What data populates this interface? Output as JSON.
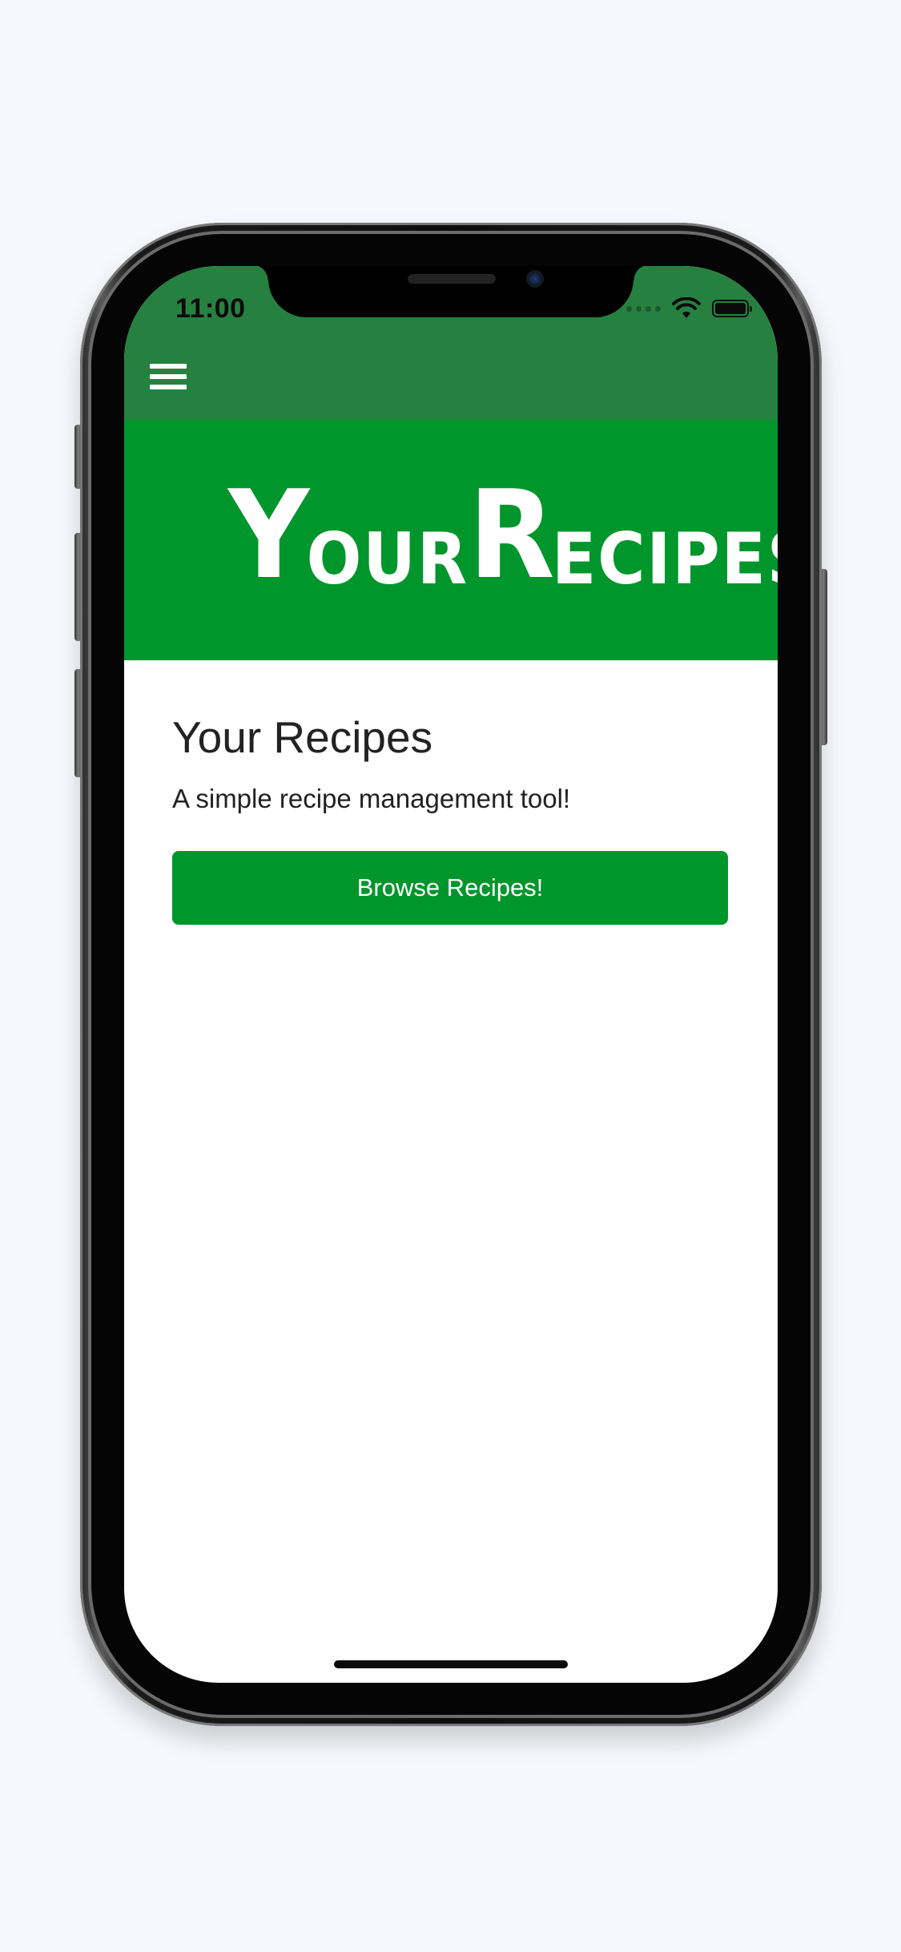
{
  "status_bar": {
    "time": "11:00",
    "icons": [
      "signal-icon",
      "wifi-icon",
      "battery-icon"
    ]
  },
  "nav": {
    "menu_icon": "hamburger-menu-icon",
    "background_color": "#268140"
  },
  "hero": {
    "logo_text": "YourRecipes",
    "logo_parts": [
      "Y",
      "OUR",
      "R",
      "ECIPES"
    ],
    "background_color": "#00962c"
  },
  "main": {
    "title": "Your Recipes",
    "subtitle": "A simple recipe management tool!",
    "browse_button_label": "Browse Recipes!"
  },
  "colors": {
    "accent": "#00962c",
    "text": "#222222",
    "page_background": "#f7f8fd"
  }
}
